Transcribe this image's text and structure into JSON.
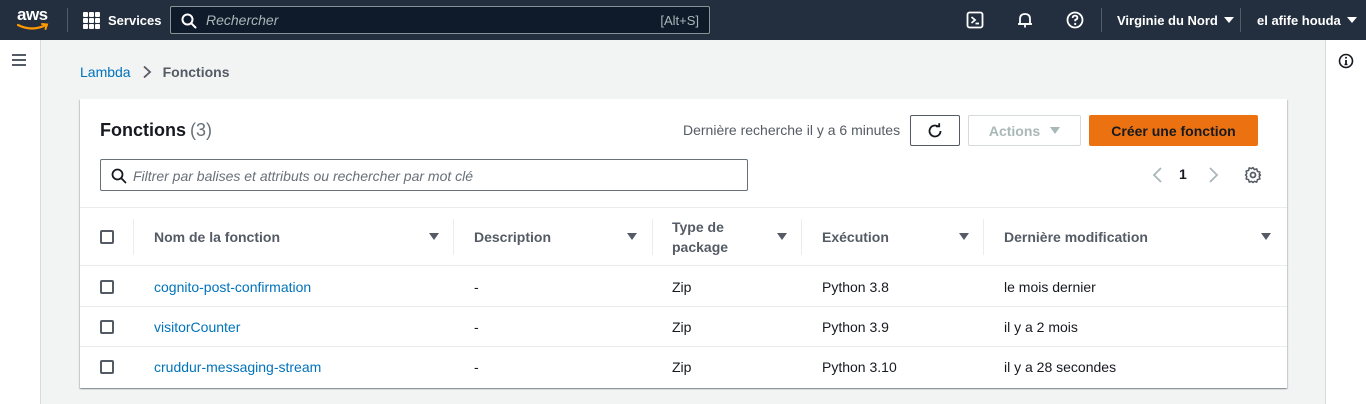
{
  "topnav": {
    "logo_text": "aws",
    "services_label": "Services",
    "search_placeholder": "Rechercher",
    "search_shortcut": "[Alt+S]",
    "region": "Virginie du Nord",
    "user": "el afife houda"
  },
  "breadcrumb": {
    "root": "Lambda",
    "current": "Fonctions"
  },
  "panel": {
    "title": "Fonctions",
    "count": "(3)",
    "last_search": "Dernière recherche il y a 6 minutes",
    "actions_label": "Actions",
    "create_label": "Créer une fonction",
    "filter_placeholder": "Filtrer par balises et attributs ou rechercher par mot clé",
    "page": "1"
  },
  "table": {
    "headers": {
      "name": "Nom de la fonction",
      "description": "Description",
      "package_type": "Type de package",
      "runtime": "Exécution",
      "last_modified": "Dernière modification"
    },
    "rows": [
      {
        "name": "cognito-post-confirmation",
        "description": "-",
        "package_type": "Zip",
        "runtime": "Python 3.8",
        "last_modified": "le mois dernier"
      },
      {
        "name": "visitorCounter",
        "description": "-",
        "package_type": "Zip",
        "runtime": "Python 3.9",
        "last_modified": "il y a 2 mois"
      },
      {
        "name": "cruddur-messaging-stream",
        "description": "-",
        "package_type": "Zip",
        "runtime": "Python 3.10",
        "last_modified": "il y a 28 secondes"
      }
    ]
  },
  "colors": {
    "nav_bg": "#232f3e",
    "link": "#0073bb",
    "primary_button": "#ec7211",
    "page_bg": "#f2f3f3"
  }
}
